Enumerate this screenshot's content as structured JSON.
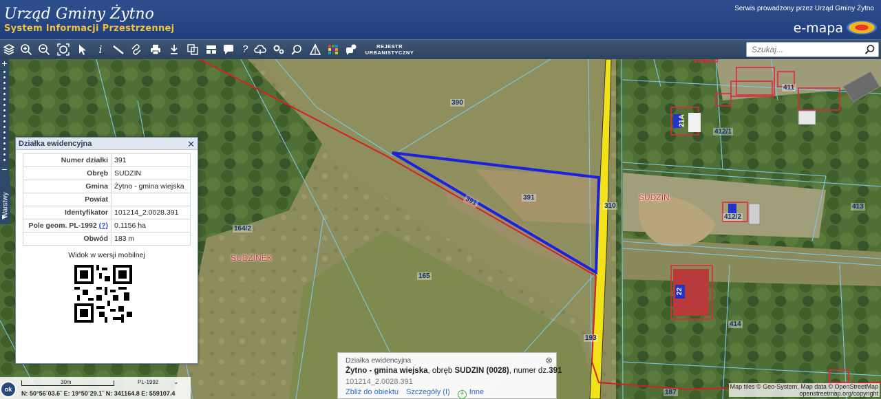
{
  "header": {
    "title": "Urząd Gminy Żytno",
    "subtitle": "System Informacji Przestrzennej",
    "provider": "Serwis prowadzony przez Urząd Gminy Żytno",
    "brand": "e-mapa"
  },
  "toolbar": {
    "tools": [
      "layers-icon",
      "zoom-in-icon",
      "zoom-out-icon",
      "zoom-extent-icon",
      "select-arrow-icon",
      "info-icon",
      "measure-ruler-icon",
      "link-icon",
      "print-icon",
      "download-icon",
      "copy-icon",
      "layout-icon",
      "comment-icon",
      "help-icon",
      "cloud-icon",
      "settings-icon",
      "zoom-search-icon",
      "terrain-icon",
      "color-palette-icon",
      "chat-icon"
    ],
    "rejestr_label": "REJESTR URBANISTYCZNY",
    "search_placeholder": "Szukaj..."
  },
  "left_bar": {
    "layers_label": "Warstwy",
    "zoom_in": "+",
    "zoom_out": "−"
  },
  "panel": {
    "title": "Działka ewidencyjna",
    "rows": [
      {
        "key": "Numer działki",
        "value": "391"
      },
      {
        "key": "Obręb",
        "value": "SUDZIN"
      },
      {
        "key": "Gmina",
        "value": "Żytno - gmina wiejska"
      },
      {
        "key": "Powiat",
        "value": ""
      },
      {
        "key": "Identyfikator",
        "value": "101214_2.0028.391"
      },
      {
        "key": "Pole geom. PL-1992",
        "help": "(?)",
        "value": "0.1156 ha"
      },
      {
        "key": "Obwód",
        "value": "183 m"
      }
    ],
    "mobile_label": "Widok w wersji mobilnej"
  },
  "bubble": {
    "title": "Działka ewidencyjna",
    "gmina": "Żytno - gmina wiejska",
    "sep1": ", obręb ",
    "obreb": "SUDZIN (0028)",
    "sep2": ", numer dz.",
    "numer": "391",
    "identifier": "101214_2.0028.391",
    "link_zoom": "Zbliż do obiektu",
    "link_details": "Szczegóły (I)",
    "link_other": "Inne"
  },
  "map": {
    "parcel_labels": [
      "390",
      "391",
      "391",
      "310",
      "165",
      "164/2",
      "193",
      "187",
      "411",
      "412/1",
      "412/2",
      "413",
      "414",
      "21A",
      "22"
    ],
    "place_labels": [
      "SUDZIN",
      "SUDZINEK"
    ]
  },
  "status": {
    "ok": "ok",
    "scale": "30m",
    "crs": "PL-1992",
    "coords": "N: 50°56´03.6˝  E: 19°50´29.1˝  N: 341164.8  E: 559107.4"
  },
  "attribution": {
    "line1": "Map tiles © Geo-System, Map data © OpenStreetMap",
    "line2": "openstreetmap.org/copyright"
  },
  "colors": {
    "header_bg": "#1f3e7c",
    "subtitle": "#f2c23a",
    "selected_parcel": "#1a22e0",
    "boundary_red": "#d62020",
    "parcel_line": "#7fc6e8",
    "road_yellow": "#f2e21a"
  }
}
